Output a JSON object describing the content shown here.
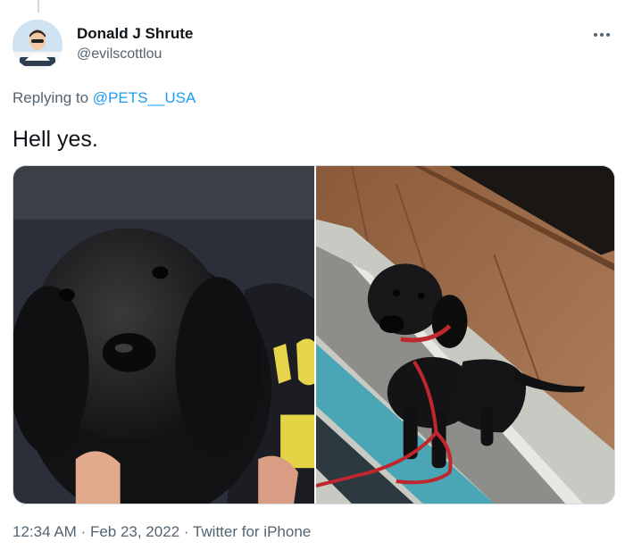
{
  "tweet": {
    "author": {
      "name": "Donald J Shrute",
      "handle": "@evilscottlou"
    },
    "reply": {
      "prefix": "Replying to",
      "target": "@PETS__USA"
    },
    "text": "Hell yes.",
    "meta": {
      "time": "12:34 AM",
      "separator1": " · ",
      "date": "Feb 23, 2022",
      "separator2": " · ",
      "source": "Twitter for iPhone"
    },
    "media": [
      {
        "name": "photo-puppy-closeup",
        "description": ""
      },
      {
        "name": "photo-puppy-on-rug",
        "description": ""
      }
    ]
  },
  "colors": {
    "link": "#1d9bf0",
    "secondary_text": "#536471",
    "border": "#cfd9de"
  },
  "icons": {
    "more": "more-horizontal-icon"
  }
}
